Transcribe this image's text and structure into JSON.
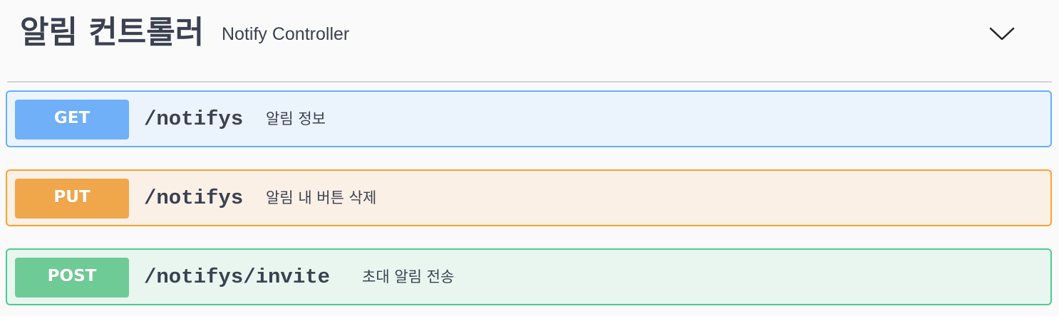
{
  "section": {
    "title": "알림 컨트롤러",
    "description": "Notify Controller",
    "toggle_icon": "chevron-down-icon"
  },
  "operations": [
    {
      "method": "GET",
      "path": "/notifys",
      "summary": "알림 정보",
      "color": "#61affe"
    },
    {
      "method": "PUT",
      "path": "/notifys",
      "summary": "알림 내 버튼 삭제",
      "color": "#fca130"
    },
    {
      "method": "POST",
      "path": "/notifys/invite",
      "summary": "초대 알림 전송",
      "color": "#49cc90"
    }
  ]
}
